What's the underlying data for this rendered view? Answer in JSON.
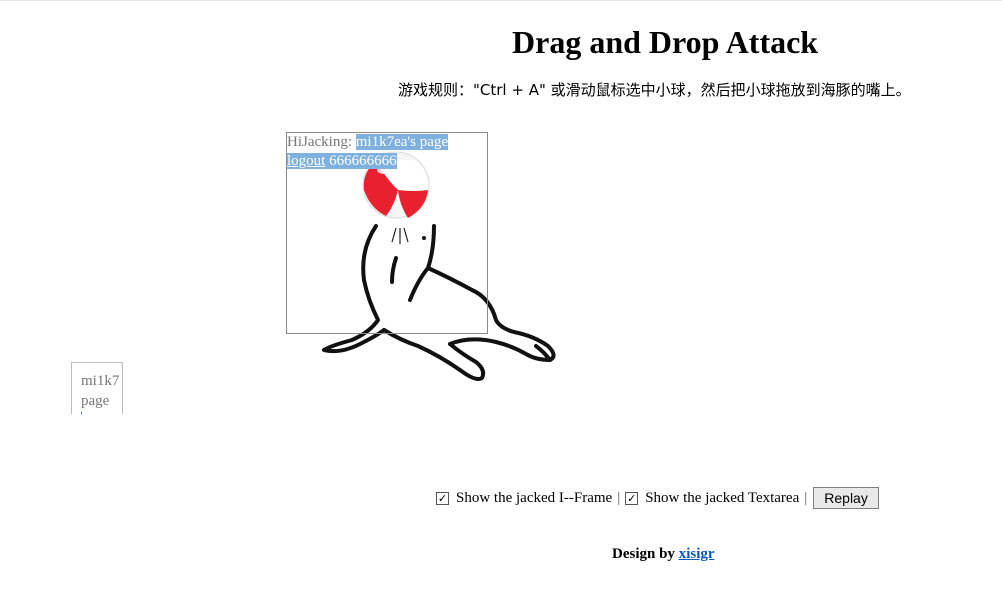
{
  "page": {
    "title": "Drag and Drop Attack",
    "rules": "游戏规则：\"Ctrl + A\" 或滑动鼠标选中小球，然后把小球拖放到海豚的嘴上。"
  },
  "jacked_frame": {
    "label": "HiJacking:",
    "page_text": "mi1k7ea's page",
    "logout_link": "logout",
    "extra_text": "666666666"
  },
  "jacked_textarea": {
    "line1": "mi1k7",
    "line2": "page"
  },
  "controls": {
    "show_frame_label": "Show the jacked I--Frame",
    "show_frame_checked": true,
    "separator1": "|",
    "show_textarea_label": "Show the jacked Textarea",
    "show_textarea_checked": true,
    "separator2": "|",
    "replay_label": "Replay"
  },
  "footer": {
    "prefix": "Design by",
    "author_link": "xisigr"
  },
  "colors": {
    "selection": "#7fb1de",
    "link": "#0b57b6",
    "ball_red": "#e8202f"
  },
  "icons": {
    "ball": "beach-ball-icon",
    "seal": "seal-illustration"
  }
}
